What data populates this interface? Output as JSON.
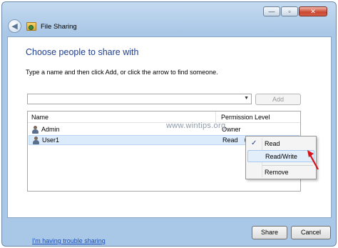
{
  "window": {
    "title": "File Sharing",
    "controls": {
      "minimize": "—",
      "maximize": "▫",
      "close": "✕"
    }
  },
  "header": {
    "back_icon": "back-arrow-icon",
    "app_icon": "file-sharing-icon"
  },
  "main": {
    "heading": "Choose people to share with",
    "instruction": "Type a name and then click Add, or click the arrow to find someone.",
    "name_input": {
      "value": "",
      "placeholder": ""
    },
    "add_label": "Add",
    "columns": {
      "name": "Name",
      "permission": "Permission Level"
    },
    "rows": [
      {
        "name": "Admin",
        "permission": "Owner"
      },
      {
        "name": "User1",
        "permission": "Read"
      }
    ],
    "watermark": "www.wintips.org"
  },
  "permission_menu": {
    "items": [
      {
        "label": "Read",
        "checked": true
      },
      {
        "label": "Read/Write",
        "checked": false
      },
      {
        "label": "Remove",
        "checked": false
      }
    ],
    "check_glyph": "✓"
  },
  "footer": {
    "trouble_link": "I'm having trouble sharing",
    "share_label": "Share",
    "cancel_label": "Cancel"
  },
  "colors": {
    "heading": "#1e3d8f",
    "annotation": "#d3141a",
    "link": "#1c4fb8"
  }
}
